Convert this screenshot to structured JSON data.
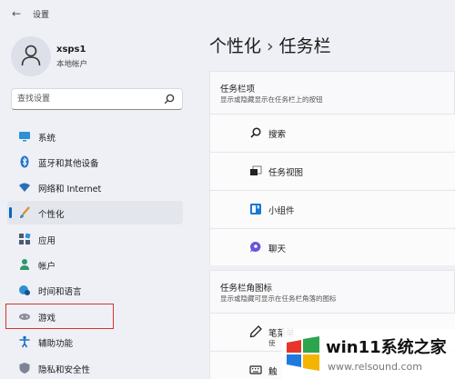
{
  "titlebar": {
    "back": "←",
    "title": "设置"
  },
  "profile": {
    "name": "xsps1",
    "type": "本地帐户"
  },
  "search": {
    "placeholder": "查找设置"
  },
  "nav": {
    "items": [
      {
        "label": "系统",
        "icon": "monitor-icon"
      },
      {
        "label": "蓝牙和其他设备",
        "icon": "bluetooth-icon"
      },
      {
        "label": "网络和 Internet",
        "icon": "wifi-icon"
      },
      {
        "label": "个性化",
        "icon": "brush-icon",
        "selected": true
      },
      {
        "label": "应用",
        "icon": "apps-icon"
      },
      {
        "label": "帐户",
        "icon": "person-icon"
      },
      {
        "label": "时间和语言",
        "icon": "globe-clock-icon"
      },
      {
        "label": "游戏",
        "icon": "gamepad-icon"
      },
      {
        "label": "辅助功能",
        "icon": "accessibility-icon"
      },
      {
        "label": "隐私和安全性",
        "icon": "shield-icon"
      }
    ]
  },
  "page": {
    "crumb1": "个性化",
    "sep": "›",
    "crumb2": "任务栏"
  },
  "taskbar_items": {
    "title": "任务栏项",
    "subtitle": "显示或隐藏显示在任务栏上的按钮",
    "rows": [
      "搜索",
      "任务视图",
      "小组件",
      "聊天"
    ]
  },
  "corner_icons": {
    "title": "任务栏角图标",
    "subtitle": "显示或隐藏可显示在任务栏角落的图标",
    "rows": [
      {
        "label": "笔菜单",
        "sub": "使"
      },
      {
        "label": "触",
        "sub": ""
      }
    ]
  },
  "watermark": {
    "text": "win11系统之家",
    "url": "www.relsound.com"
  },
  "colors": {
    "accent": "#0067c0",
    "highlight": "#d2352e"
  }
}
